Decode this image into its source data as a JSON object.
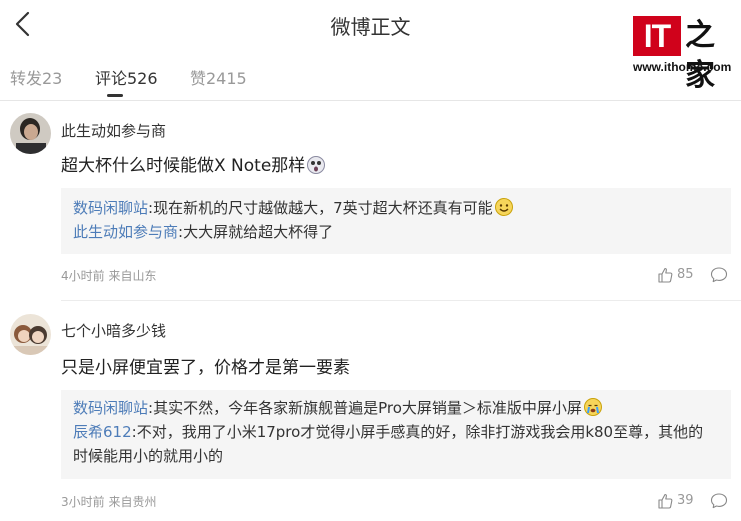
{
  "header": {
    "title": "微博正文"
  },
  "logo": {
    "it": "IT",
    "zh": "之家",
    "url": "www.ithome.com"
  },
  "tabs": [
    {
      "label": "转发23"
    },
    {
      "label": "评论526"
    },
    {
      "label": "赞2415"
    }
  ],
  "comments": [
    {
      "username": "此生动如参与商",
      "text": "超大杯什么时候能做X Note那样",
      "replies": [
        {
          "name": "数码闲聊站",
          "text": ":现在新机的尺寸越做越大，7英寸超大杯还真有可能"
        },
        {
          "name": "此生动如参与商",
          "text": ":大大屏就给超大杯得了"
        }
      ],
      "meta": "4小时前 来自山东",
      "likes": "85"
    },
    {
      "username": "七个小暗多少钱",
      "text": "只是小屏便宜罢了，价格才是第一要素",
      "replies": [
        {
          "name": "数码闲聊站",
          "text": ":其实不然，今年各家新旗舰普遍是Pro大屏销量＞标准版中屏小屏"
        },
        {
          "name": "辰希612",
          "text": ":不对，我用了小米17pro才觉得小屏手感真的好，除非打游戏我会用k80至尊，其他的时候能用小的就用小的"
        }
      ],
      "meta": "3小时前 来自贵州",
      "likes": "39"
    }
  ]
}
